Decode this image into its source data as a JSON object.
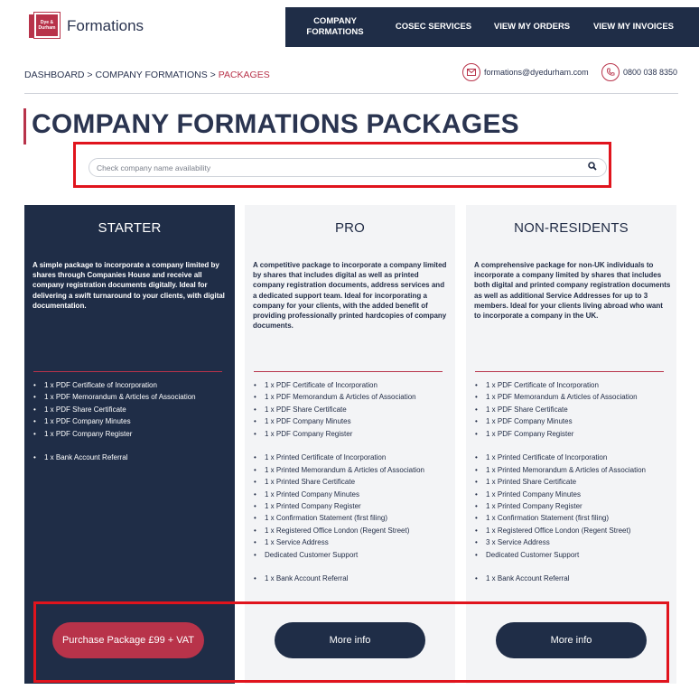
{
  "logo": {
    "mark_line1": "Dye &",
    "mark_line2": "Durham",
    "text": "Formations"
  },
  "nav": [
    {
      "label": "COMPANY\nFORMATIONS"
    },
    {
      "label": "COSEC SERVICES"
    },
    {
      "label": "VIEW MY ORDERS"
    },
    {
      "label": "VIEW MY INVOICES"
    }
  ],
  "breadcrumb": {
    "part1": "DASHBOARD",
    "sep": " > ",
    "part2": "COMPANY FORMATIONS",
    "current": "PACKAGES"
  },
  "contact": {
    "email": "formations@dyedurham.com",
    "phone": "0800 038 8350",
    "email_icon": "mail-icon",
    "phone_icon": "phone-icon"
  },
  "page_title": "COMPANY FORMATIONS PACKAGES",
  "search": {
    "placeholder": "Check company name availability",
    "value": "",
    "icon": "search-icon"
  },
  "packages": [
    {
      "name": "STARTER",
      "description": "A simple package to incorporate a company limited by shares through Companies House and receive all company registration documents digitally. Ideal for delivering a swift turnaround to your clients, with digital documentation.",
      "items": [
        "1 x PDF Certificate of Incorporation",
        "1 x PDF Memorandum & Articles of Association",
        "1 x PDF Share Certificate",
        "1 x PDF Company Minutes",
        "1 x PDF Company Register",
        "",
        "1 x Bank Account Referral"
      ],
      "button": "Purchase Package £99 + VAT"
    },
    {
      "name": "PRO",
      "description": "A competitive package to incorporate a company limited by shares that includes digital as well as printed company registration documents, address services and a dedicated support team. Ideal for incorporating a company for your clients, with the added benefit of providing professionally printed hardcopies of company documents.",
      "items": [
        "1 x PDF Certificate of Incorporation",
        "1 x PDF Memorandum & Articles of Association",
        "1 x PDF Share Certificate",
        "1 x PDF Company Minutes",
        "1 x PDF Company Register",
        "",
        "1 x Printed Certificate of Incorporation",
        "1 x Printed Memorandum & Articles of Association",
        "1 x Printed Share Certificate",
        "1 x Printed Company Minutes",
        "1 x Printed Company Register",
        "1 x Confirmation Statement (first filing)",
        "1 x Registered Office London (Regent Street)",
        "1 x Service Address",
        "Dedicated Customer Support",
        "",
        "1 x Bank Account Referral"
      ],
      "button": "More info"
    },
    {
      "name": "NON-RESIDENTS",
      "description": "A comprehensive package for non-UK individuals to incorporate a company limited by shares that includes both digital and printed company registration documents as well as additional Service Addresses for up to 3 members. Ideal for your clients living abroad who want to incorporate a company in the UK.",
      "items": [
        "1 x PDF Certificate of Incorporation",
        "1 x PDF Memorandum & Articles of Association",
        "1 x PDF Share Certificate",
        "1 x PDF Company Minutes",
        "1 x PDF Company Register",
        "",
        "1 x Printed Certificate of Incorporation",
        "1 x Printed Memorandum & Articles of Association",
        "1 x Printed Share Certificate",
        "1 x Printed Company Minutes",
        "1 x Printed Company Register",
        "1 x Confirmation Statement (first filing)",
        "1 x Registered Office London (Regent Street)",
        "3 x Service Address",
        "Dedicated Customer Support",
        "",
        "1 x Bank Account Referral"
      ],
      "button": "More info"
    }
  ],
  "colors": {
    "navy": "#1f2d47",
    "accent": "#b8334a",
    "highlight_red": "#e0141d",
    "card_bg": "#f3f4f6"
  }
}
